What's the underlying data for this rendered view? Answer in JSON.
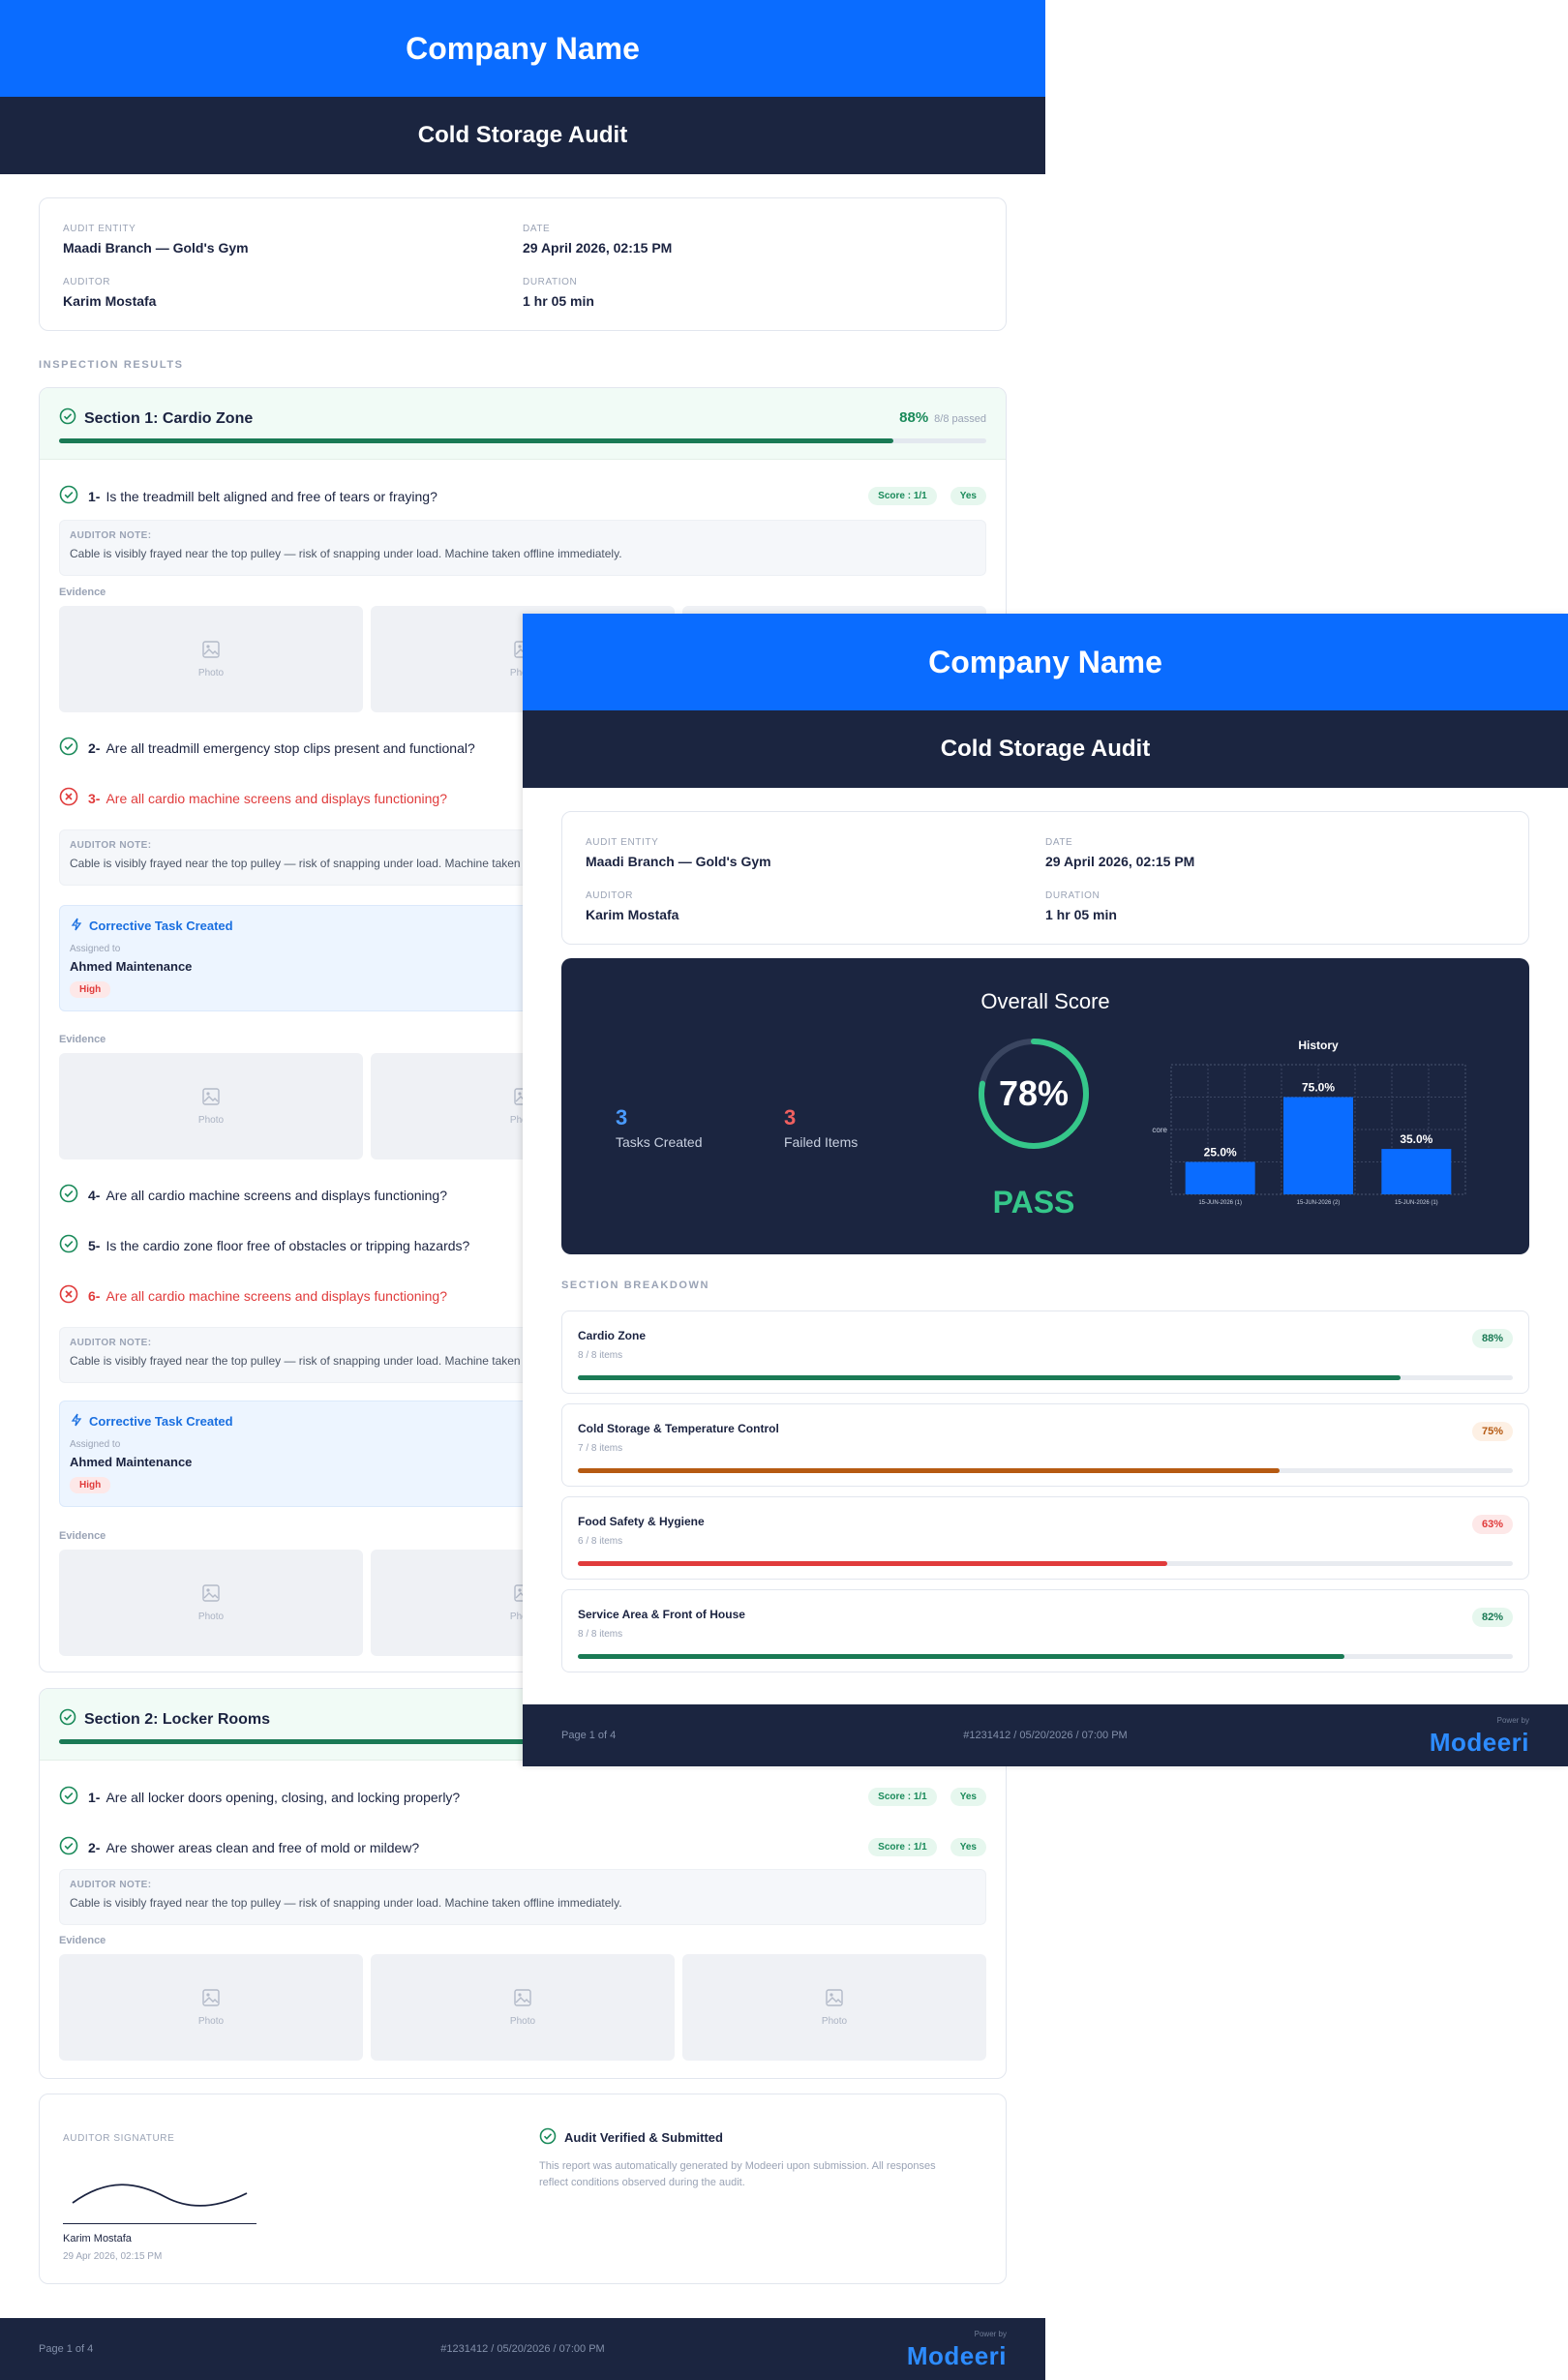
{
  "header": {
    "company": "Company Name",
    "title": "Cold Storage Audit"
  },
  "meta": {
    "entity_label": "AUDIT ENTITY",
    "entity": "Maadi Branch — Gold's Gym",
    "date_label": "DATE",
    "date": "29 April 2026, 02:15 PM",
    "auditor_label": "AUDITOR",
    "auditor": "Karim Mostafa",
    "duration_label": "DURATION",
    "duration": "1 hr 05 min"
  },
  "labels": {
    "inspection_results": "INSPECTION RESULTS",
    "auditor_note": "AUDITOR NOTE:",
    "evidence": "Evidence",
    "photo": "Photo",
    "task_created": "Corrective Task Created",
    "assigned_to": "Assigned to",
    "section_breakdown": "SECTION BREAKDOWN"
  },
  "note_text": "Cable is visibly frayed near the top pulley — risk of snapping under load. Machine taken offline immediately.",
  "task": {
    "assignee": "Ahmed Maintenance",
    "priority": "High"
  },
  "section1": {
    "title": "Section 1: Cardio Zone",
    "score": "88%",
    "passed": "8/8 passed",
    "progress": 0.9,
    "questions": [
      {
        "num": "1-",
        "text": "Is the treadmill belt aligned and free of tears or fraying?",
        "score": "Score : 1/1",
        "answer": "Yes"
      },
      {
        "num": "2-",
        "text": "Are all treadmill emergency stop clips present and functional?"
      },
      {
        "num": "3-",
        "text": "Are all cardio machine screens and displays functioning?"
      },
      {
        "num": "4-",
        "text": "Are all cardio machine screens and displays functioning?"
      },
      {
        "num": "5-",
        "text": "Is the cardio zone floor free of obstacles or tripping hazards?"
      },
      {
        "num": "6-",
        "text": "Are all cardio machine screens and displays functioning?"
      }
    ]
  },
  "section2": {
    "title": "Section 2: Locker Rooms",
    "questions": [
      {
        "num": "1-",
        "text": "Are all locker doors opening, closing, and locking properly?",
        "score": "Score : 1/1",
        "answer": "Yes"
      },
      {
        "num": "2-",
        "text": "Are shower areas clean and free of mold or mildew?",
        "score": "Score : 1/1",
        "answer": "Yes"
      }
    ]
  },
  "signature": {
    "label": "AUDITOR SIGNATURE",
    "name": "Karim Mostafa",
    "date": "29 Apr 2026, 02:15 PM",
    "verified": "Audit Verified & Submitted",
    "verified_text_1": "This report was automatically generated by Modeeri upon submission. All responses",
    "verified_text_2": "reflect conditions observed during the audit."
  },
  "footer": {
    "page": "Page 1 of 4",
    "ref": "#1231412 / 05/20/2026 / 07:00 PM",
    "powered": "Power by",
    "brand": "Modeeri"
  },
  "overall": {
    "title": "Overall Score",
    "tasks_count": "3",
    "tasks_label": "Tasks Created",
    "failed_count": "3",
    "failed_label": "Failed Items",
    "score": "78%",
    "score_fraction": 0.78,
    "result": "PASS",
    "colors": {
      "tasks": "#4a9bff",
      "failed": "#f06060",
      "ring": "#35c78a"
    }
  },
  "chart_data": {
    "type": "bar",
    "title": "History",
    "ylabel": "Score",
    "categories": [
      "15-JUN-2026 (1)",
      "15-JUN-2026 (2)",
      "15-JUN-2026 (1)"
    ],
    "values": [
      25.0,
      75.0,
      35.0
    ],
    "value_labels": [
      "25.0%",
      "75.0%",
      "35.0%"
    ],
    "ylim": [
      0,
      100
    ],
    "grid": true,
    "bar_color": "#0a6cff"
  },
  "breakdown": [
    {
      "name": "Cardio Zone",
      "items": "8 / 8 items",
      "pct": "88%",
      "fill": 0.88,
      "color": "#1a7a55",
      "badge_bg": "#e6f7ee"
    },
    {
      "name": "Cold Storage & Temperature Control",
      "items": "7 / 8 items",
      "pct": "75%",
      "fill": 0.75,
      "color": "#b65a12",
      "badge_bg": "#fdf0e4"
    },
    {
      "name": "Food Safety & Hygiene",
      "items": "6 / 8 items",
      "pct": "63%",
      "fill": 0.63,
      "color": "#e03b3b",
      "badge_bg": "#fde8e8"
    },
    {
      "name": "Service Area & Front of House",
      "items": "8 / 8 items",
      "pct": "82%",
      "fill": 0.82,
      "color": "#1a7a55",
      "badge_bg": "#e6f7ee"
    }
  ]
}
